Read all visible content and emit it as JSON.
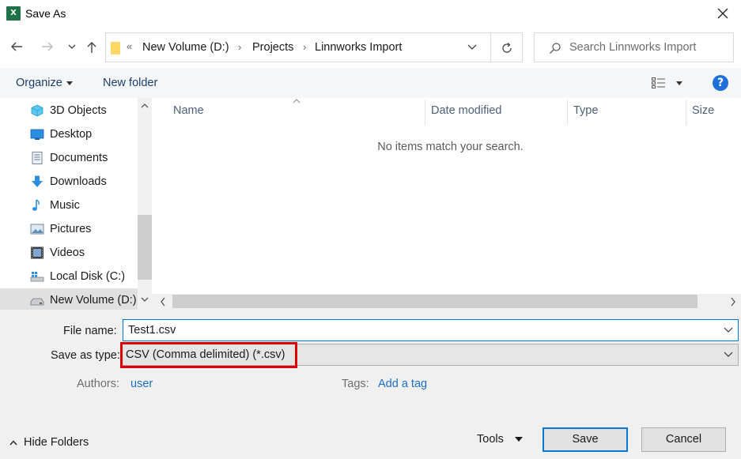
{
  "window": {
    "title": "Save As",
    "app_icon_text": "X"
  },
  "address": {
    "overflow": "«",
    "crumbs": [
      "New Volume (D:)",
      "Projects",
      "Linnworks Import"
    ],
    "search_placeholder": "Search Linnworks Import"
  },
  "toolbar": {
    "organize_label": "Organize",
    "new_folder_label": "New folder",
    "help_label": "?"
  },
  "sidebar": {
    "items": [
      {
        "label": "3D Objects",
        "icon": "3d-objects-icon"
      },
      {
        "label": "Desktop",
        "icon": "desktop-icon"
      },
      {
        "label": "Documents",
        "icon": "documents-icon"
      },
      {
        "label": "Downloads",
        "icon": "downloads-icon"
      },
      {
        "label": "Music",
        "icon": "music-icon"
      },
      {
        "label": "Pictures",
        "icon": "pictures-icon"
      },
      {
        "label": "Videos",
        "icon": "videos-icon"
      },
      {
        "label": "Local Disk (C:)",
        "icon": "local-disk-icon"
      },
      {
        "label": "New Volume (D:)",
        "icon": "drive-icon",
        "selected": true
      }
    ]
  },
  "files": {
    "columns": [
      "Name",
      "Date modified",
      "Type",
      "Size"
    ],
    "empty_message": "No items match your search."
  },
  "form": {
    "file_name_label": "File name:",
    "file_name_value": "Test1.csv",
    "save_type_label": "Save as type:",
    "save_type_value": "CSV (Comma delimited) (*.csv)",
    "authors_label": "Authors:",
    "authors_value": "user",
    "tags_label": "Tags:",
    "tags_value": "Add a tag"
  },
  "footer": {
    "hide_folders_label": "Hide Folders",
    "tools_label": "Tools",
    "save_label": "Save",
    "cancel_label": "Cancel"
  },
  "colors": {
    "accent": "#0078d7",
    "highlight": "#e00000",
    "excel_green": "#1f7244",
    "link": "#1a6fc6"
  }
}
